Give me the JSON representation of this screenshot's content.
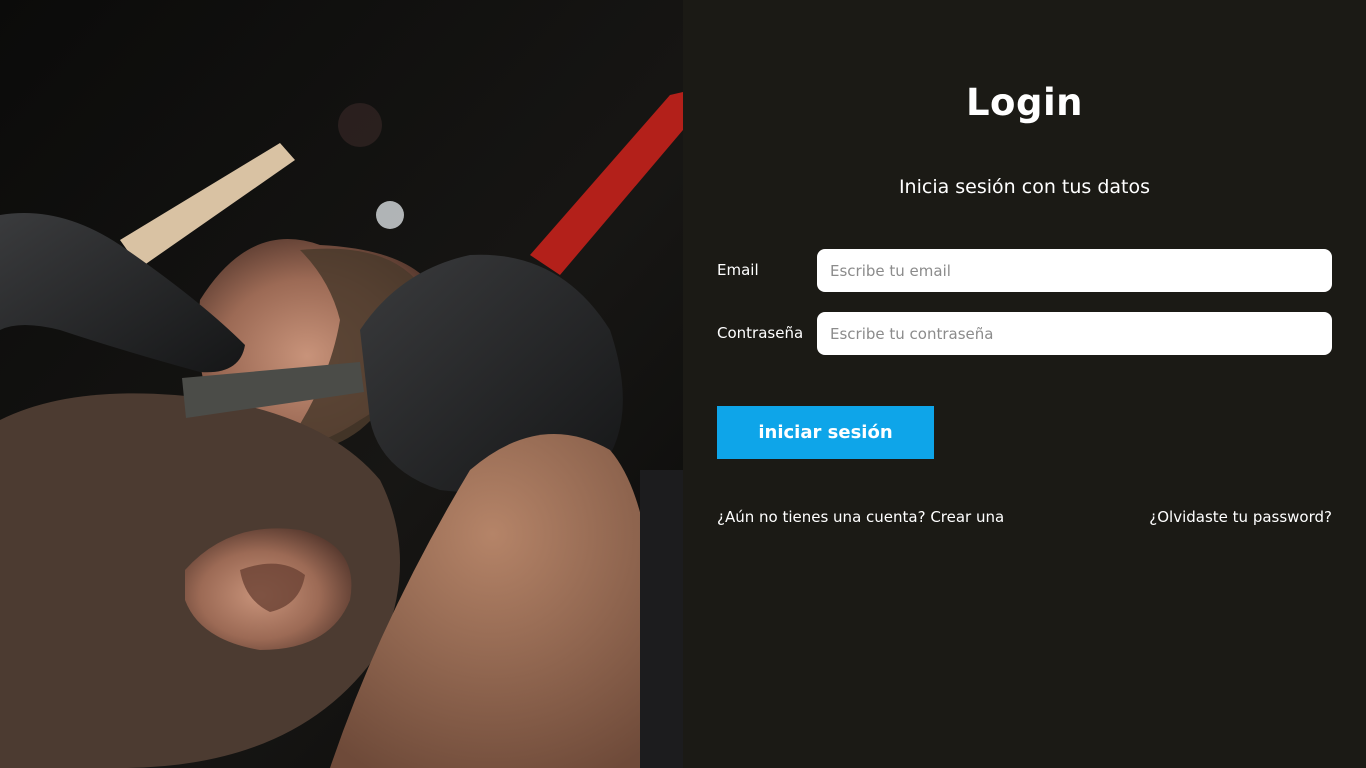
{
  "hero_image": {
    "subject": "barber shaving a man's beard with a straight razor, wearing black gloves"
  },
  "login": {
    "title": "Login",
    "subtitle": "Inicia sesión con tus datos",
    "email_label": "Email",
    "email_placeholder": "Escribe tu email",
    "password_label": "Contraseña",
    "password_placeholder": "Escribe tu contraseña",
    "submit_label": "iniciar sesión",
    "create_account_link": "¿Aún no tienes una cuenta? Crear una",
    "forgot_password_link": "¿Olvidaste tu password?"
  },
  "colors": {
    "panel_background": "#1b1a15",
    "accent": "#0ea5e9",
    "text": "#ffffff",
    "input_background": "#ffffff"
  }
}
